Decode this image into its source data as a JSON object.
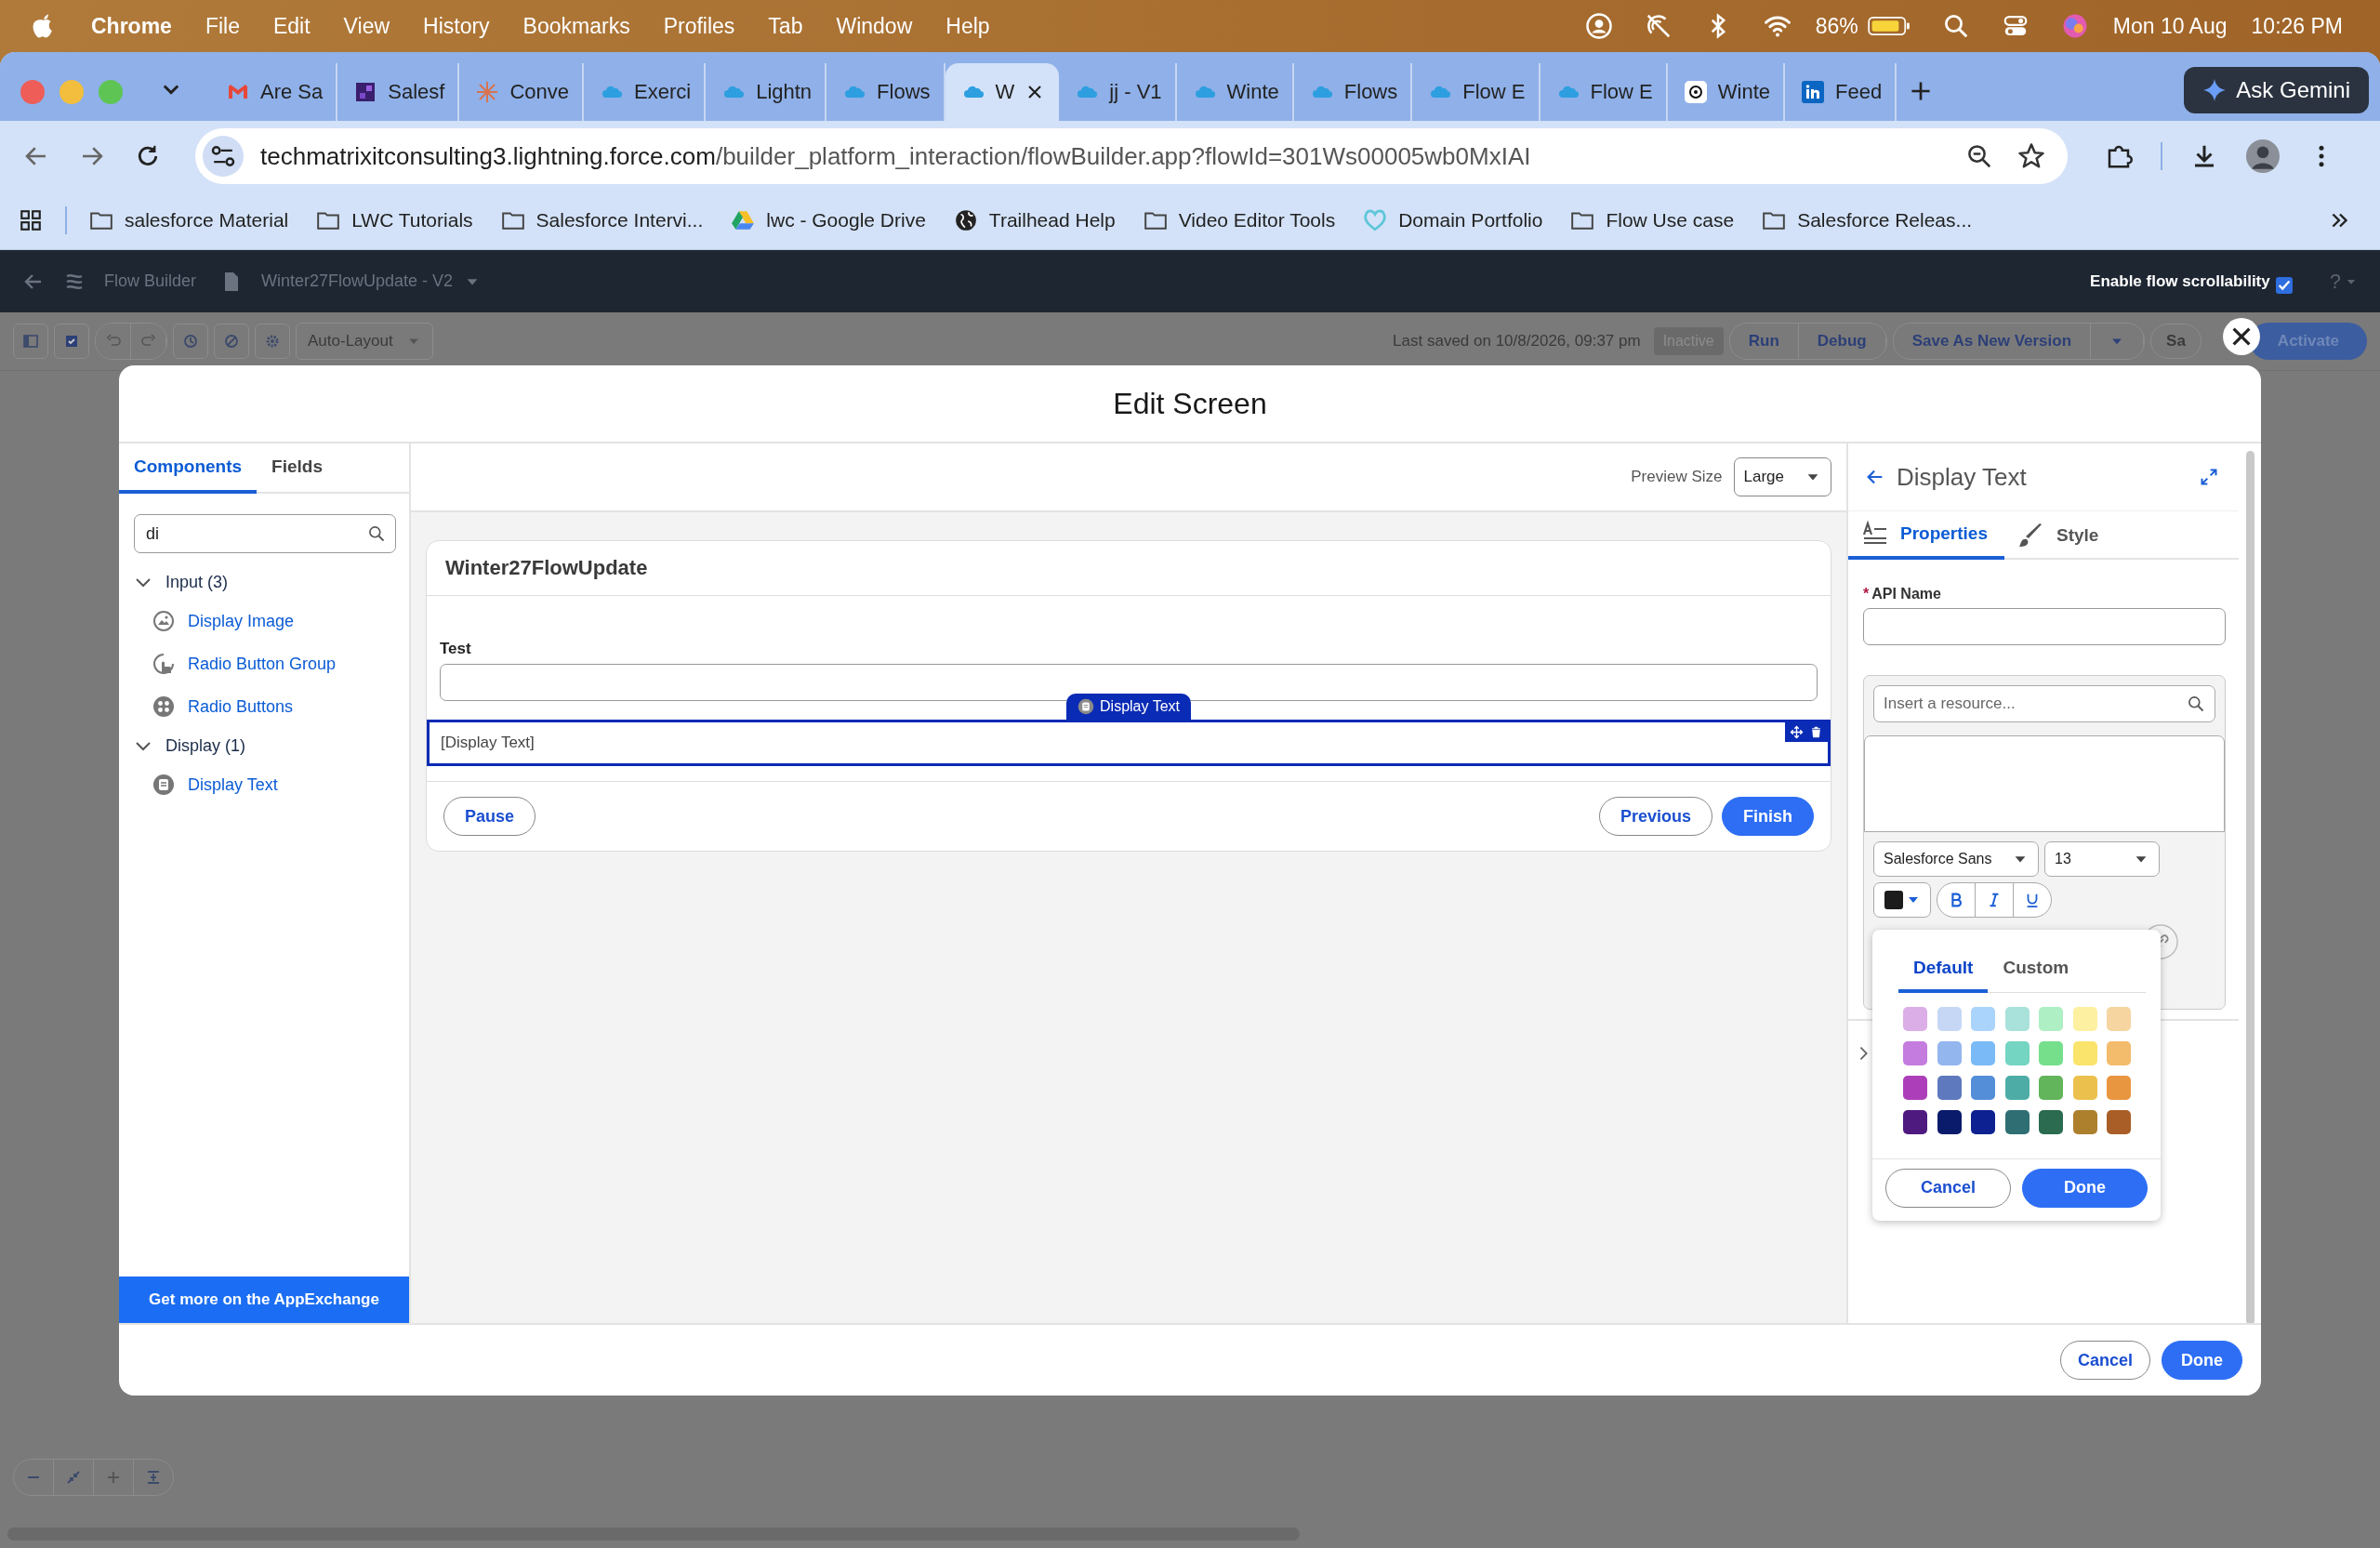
{
  "menubar": {
    "app": "Chrome",
    "menus": [
      "File",
      "Edit",
      "View",
      "History",
      "Bookmarks",
      "Profiles",
      "Tab",
      "Window",
      "Help"
    ],
    "battery": "86%",
    "date": "Mon 10 Aug",
    "time": "10:26 PM"
  },
  "browser_tabs": [
    {
      "title": "Are Sa",
      "kind": "mail",
      "selected": false
    },
    {
      "title": "Salesf",
      "kind": "square",
      "selected": false
    },
    {
      "title": "Conve",
      "kind": "burst",
      "selected": false
    },
    {
      "title": "Exerci",
      "kind": "cloud",
      "selected": false
    },
    {
      "title": "Lightn",
      "kind": "cloud",
      "selected": false
    },
    {
      "title": "Flows",
      "kind": "cloud",
      "selected": false
    },
    {
      "title": "W",
      "kind": "cloud",
      "selected": true
    },
    {
      "title": "jj - V1",
      "kind": "cloud",
      "selected": false
    },
    {
      "title": "Winte",
      "kind": "cloud",
      "selected": false
    },
    {
      "title": "Flows",
      "kind": "cloud",
      "selected": false
    },
    {
      "title": "Flow E",
      "kind": "cloud",
      "selected": false
    },
    {
      "title": "Flow E",
      "kind": "cloud",
      "selected": false
    },
    {
      "title": "Winte",
      "kind": "knot",
      "selected": false
    },
    {
      "title": "Feed",
      "kind": "in",
      "selected": false
    }
  ],
  "gemini_button": "Ask Gemini",
  "address": {
    "host": "techmatrixitconsulting3.lightning.force.com",
    "path": "/builder_platform_interaction/flowBuilder.app?flowId=301Ws00005wb0MxIAI"
  },
  "bookmarks": [
    {
      "label": "salesforce Material",
      "kind": "folder"
    },
    {
      "label": "LWC Tutorials",
      "kind": "folder"
    },
    {
      "label": "Salesforce Intervi...",
      "kind": "folder"
    },
    {
      "label": "lwc - Google Drive",
      "kind": "drive"
    },
    {
      "label": "Trailhead Help",
      "kind": "globe"
    },
    {
      "label": "Video Editor Tools",
      "kind": "folder"
    },
    {
      "label": "Domain Portfolio",
      "kind": "heart"
    },
    {
      "label": "Flow Use case",
      "kind": "folder"
    },
    {
      "label": "Salesforce Releas...",
      "kind": "folder"
    }
  ],
  "app_header": {
    "app_name": "Flow Builder",
    "flow_name": "Winter27FlowUpdate - V2",
    "scroll_label": "Enable flow scrollability",
    "scroll_checked": true,
    "help": "?"
  },
  "toolbar": {
    "layout": "Auto-Layout",
    "last_saved": "Last saved on 10/8/2026, 09:37 pm",
    "status": "Inactive",
    "buttons": [
      "Run",
      "Debug",
      "Save As New Version"
    ],
    "save_partial": "Sa",
    "activate": "Activate"
  },
  "modal": {
    "title": "Edit Screen",
    "left": {
      "tabs": [
        {
          "label": "Components",
          "selected": true
        },
        {
          "label": "Fields",
          "selected": false
        }
      ],
      "search": "di",
      "tree": [
        {
          "label": "Input (3)",
          "expanded": true,
          "children": [
            {
              "label": "Display Image",
              "kind": "image"
            },
            {
              "label": "Radio Button Group",
              "kind": "hand"
            },
            {
              "label": "Radio Buttons",
              "kind": "dots"
            }
          ]
        },
        {
          "label": "Display (1)",
          "expanded": true,
          "children": [
            {
              "label": "Display Text",
              "kind": "text"
            }
          ]
        }
      ],
      "footer": "Get more on the AppExchange"
    },
    "canvas": {
      "preview_label": "Preview Size",
      "preview_value": "Large",
      "screen_title": "Winter27FlowUpdate",
      "field_label": "Test",
      "badge": "Display Text",
      "component_text": "[Display Text]",
      "pause": "Pause",
      "previous": "Previous",
      "finish": "Finish"
    },
    "properties": {
      "title": "Display Text",
      "tabs": [
        {
          "label": "Properties",
          "selected": true
        },
        {
          "label": "Style",
          "selected": false
        }
      ],
      "required_mark": "*",
      "api_label": "API Name",
      "resource_placeholder": "Insert a resource...",
      "font": "Salesforce Sans",
      "size": "13",
      "picker": {
        "tabs": [
          {
            "label": "Default",
            "selected": true
          },
          {
            "label": "Custom",
            "selected": false
          }
        ],
        "swatches": [
          {
            "color": "#dcaee8"
          },
          {
            "color": "#c5d7f5"
          },
          {
            "color": "#aad4fb"
          },
          {
            "color": "#a8e2da"
          },
          {
            "color": "#aeefc4"
          },
          {
            "color": "#fdf0a0"
          },
          {
            "color": "#f6d5a0"
          },
          {
            "color": "#c47cde"
          },
          {
            "color": "#93b6ee"
          },
          {
            "color": "#7abaf6"
          },
          {
            "color": "#74d5c2"
          },
          {
            "color": "#76df8c"
          },
          {
            "color": "#fae46c"
          },
          {
            "color": "#f3bb6c"
          },
          {
            "color": "#ac3fb9"
          },
          {
            "color": "#5e79bd"
          },
          {
            "color": "#558ed8"
          },
          {
            "color": "#4dada6"
          },
          {
            "color": "#62b55a"
          },
          {
            "color": "#ebc04d"
          },
          {
            "color": "#e8963f"
          },
          {
            "color": "#4f1a80"
          },
          {
            "color": "#0b1b6b"
          },
          {
            "color": "#0d2290"
          },
          {
            "color": "#2f6f73"
          },
          {
            "color": "#2b6b4f"
          },
          {
            "color": "#ad802e"
          },
          {
            "color": "#a95e27"
          }
        ],
        "cancel": "Cancel",
        "done": "Done"
      }
    },
    "cancel": "Cancel",
    "done": "Done"
  }
}
